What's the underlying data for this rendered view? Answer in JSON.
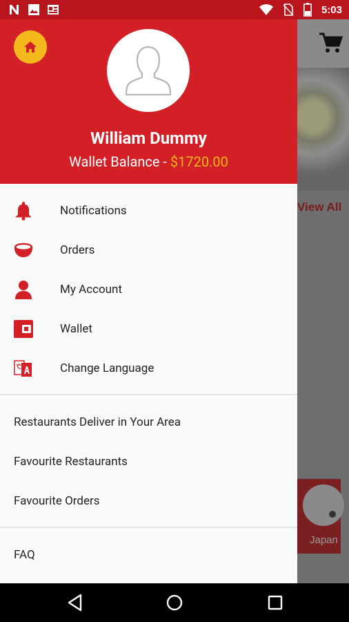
{
  "status_bar": {
    "time": "5:03",
    "left_icons": [
      "n-notification-icon",
      "image-notification-icon",
      "news-notification-icon"
    ],
    "right_icons": [
      "wifi-icon",
      "no-sim-icon",
      "battery-icon"
    ],
    "color": "#b8161c"
  },
  "drawer": {
    "user_name": "William Dummy",
    "wallet_label": "Wallet Balance - ",
    "wallet_amount": "$1720.00",
    "header_color": "#d32027",
    "accent_color": "#f5b81d",
    "primary_items": [
      {
        "label": "Notifications",
        "icon": "bell-icon"
      },
      {
        "label": "Orders",
        "icon": "bowl-icon"
      },
      {
        "label": "My Account",
        "icon": "person-icon"
      },
      {
        "label": "Wallet",
        "icon": "wallet-icon"
      },
      {
        "label": "Change Language",
        "icon": "translate-icon"
      }
    ],
    "secondary_items": [
      {
        "label": "Restaurants Deliver in Your Area"
      },
      {
        "label": "Favourite Restaurants"
      },
      {
        "label": "Favourite Orders"
      }
    ],
    "tertiary_items": [
      {
        "label": "FAQ"
      }
    ]
  },
  "background_app": {
    "view_all_label": "View All",
    "tile_label": "Japan"
  },
  "nav_bar": {
    "buttons": [
      "back-icon",
      "home-circle-icon",
      "recents-icon"
    ]
  }
}
